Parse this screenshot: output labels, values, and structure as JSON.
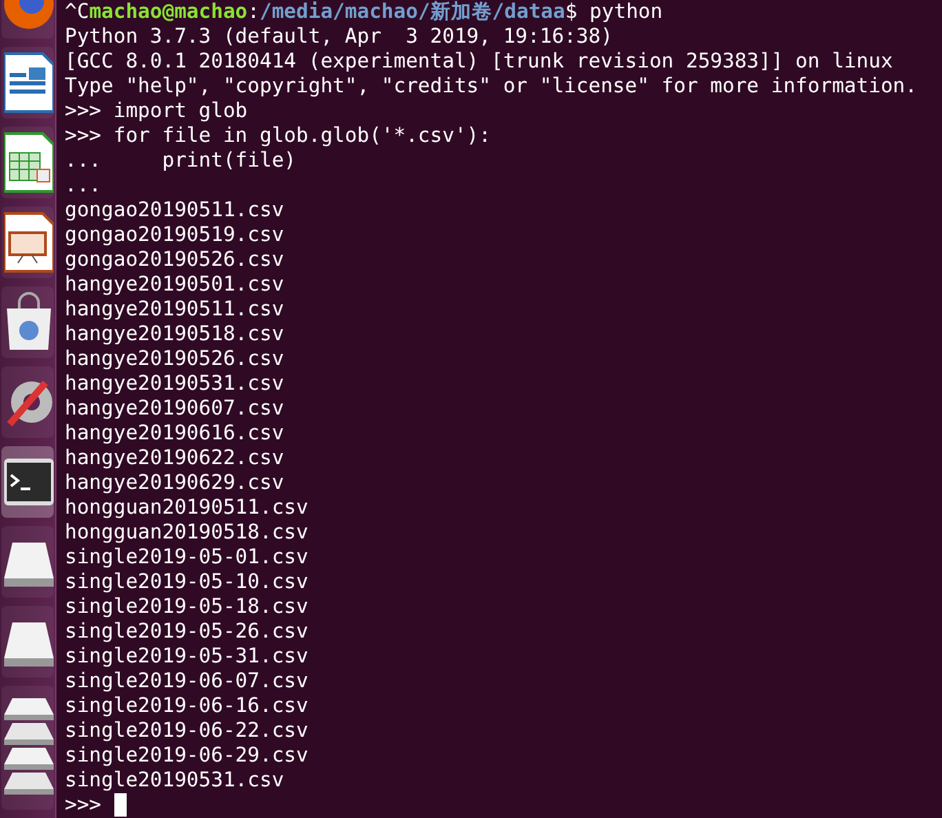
{
  "launcher": {
    "items": [
      {
        "kind": "browser",
        "selected": false
      },
      {
        "kind": "writer",
        "selected": false
      },
      {
        "kind": "calc",
        "selected": false
      },
      {
        "kind": "impress",
        "selected": false
      },
      {
        "kind": "store",
        "selected": false
      },
      {
        "kind": "settings",
        "selected": false
      },
      {
        "kind": "terminal",
        "selected": true
      },
      {
        "kind": "drive",
        "selected": false
      },
      {
        "kind": "drive",
        "selected": false
      },
      {
        "kind": "drives",
        "selected": false
      }
    ]
  },
  "terminal": {
    "prompt": {
      "prefix": "^C",
      "user": "machao@machao",
      "separator": ":",
      "path": "/media/machao/新加卷/dataa",
      "command": "$ python"
    },
    "lines": [
      "Python 3.7.3 (default, Apr  3 2019, 19:16:38)",
      "[GCC 8.0.1 20180414 (experimental) [trunk revision 259383]] on linux",
      "Type \"help\", \"copyright\", \"credits\" or \"license\" for more information.",
      ">>> import glob",
      ">>> for file in glob.glob('*.csv'):",
      "...     print(file)",
      "...",
      "gongao20190511.csv",
      "gongao20190519.csv",
      "gongao20190526.csv",
      "hangye20190501.csv",
      "hangye20190511.csv",
      "hangye20190518.csv",
      "hangye20190526.csv",
      "hangye20190531.csv",
      "hangye20190607.csv",
      "hangye20190616.csv",
      "hangye20190622.csv",
      "hangye20190629.csv",
      "hongguan20190511.csv",
      "hongguan20190518.csv",
      "single2019-05-01.csv",
      "single2019-05-10.csv",
      "single2019-05-18.csv",
      "single2019-05-26.csv",
      "single2019-05-31.csv",
      "single2019-06-07.csv",
      "single2019-06-16.csv",
      "single2019-06-22.csv",
      "single2019-06-29.csv",
      "single20190531.csv"
    ],
    "input": {
      "prompt": ">>>"
    }
  }
}
